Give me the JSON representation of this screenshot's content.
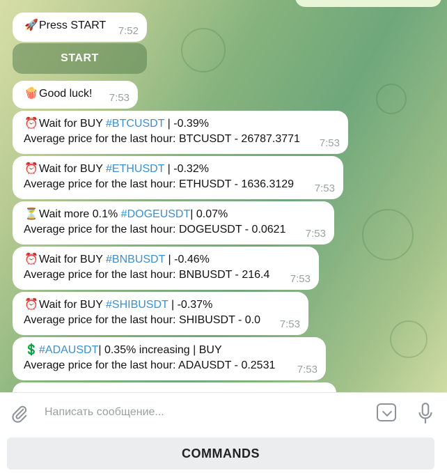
{
  "messages": [
    {
      "emoji": "🚀",
      "text": "Press START",
      "time": "7:52"
    },
    {
      "emoji": "🍿",
      "text": "Good luck!",
      "time": "7:53"
    },
    {
      "emoji": "⏰",
      "pre": "Wait for BUY ",
      "tag": "#BTCUSDT",
      "post": " | -0.39%",
      "line2": "Average price for the last hour: BTCUSDT - 26787.3771",
      "time": "7:53"
    },
    {
      "emoji": "⏰",
      "pre": "Wait for BUY ",
      "tag": "#ETHUSDT",
      "post": " | -0.32%",
      "line2": "Average price for the last hour: ETHUSDT - 1636.3129",
      "time": "7:53"
    },
    {
      "emoji": "⏳",
      "pre": "Wait more 0.1%  ",
      "tag": "#DOGEUSDT",
      "post": "| 0.07%",
      "line2": "Average price for the last hour: DOGEUSDT - 0.0621",
      "time": "7:53"
    },
    {
      "emoji": "⏰",
      "pre": "Wait for BUY ",
      "tag": "#BNBUSDT",
      "post": " | -0.46%",
      "line2": "Average price for the last hour: BNBUSDT - 216.4",
      "time": "7:53"
    },
    {
      "emoji": "⏰",
      "pre": "Wait for BUY ",
      "tag": "#SHIBUSDT",
      "post": " | -0.37%",
      "line2": "Average price for the last hour: SHIBUSDT - 0.0",
      "time": "7:53"
    },
    {
      "emoji": "💲",
      "pre": "",
      "tag": "#ADAUSDT",
      "post": "| 0.35% increasing | BUY",
      "line2": "Average price for the last hour: ADAUSDT - 0.2531",
      "time": "7:53"
    }
  ],
  "start_button": "START",
  "input": {
    "placeholder": "Написать сообщение..."
  },
  "commands_button": "COMMANDS",
  "icons": {
    "attach": "paperclip-icon",
    "keyboard": "keyboard-toggle-icon",
    "mic": "microphone-icon"
  }
}
